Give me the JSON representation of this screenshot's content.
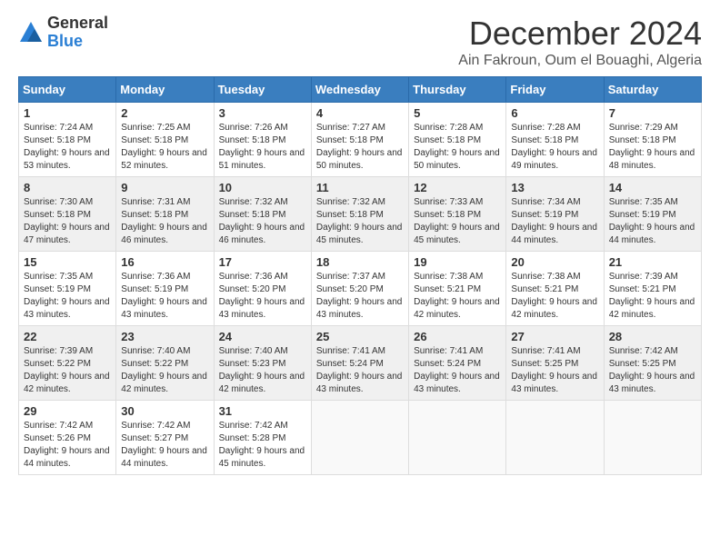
{
  "logo": {
    "general": "General",
    "blue": "Blue"
  },
  "title": "December 2024",
  "location": "Ain Fakroun, Oum el Bouaghi, Algeria",
  "headers": [
    "Sunday",
    "Monday",
    "Tuesday",
    "Wednesday",
    "Thursday",
    "Friday",
    "Saturday"
  ],
  "weeks": [
    [
      {
        "day": "1",
        "sunrise": "Sunrise: 7:24 AM",
        "sunset": "Sunset: 5:18 PM",
        "daylight": "Daylight: 9 hours and 53 minutes."
      },
      {
        "day": "2",
        "sunrise": "Sunrise: 7:25 AM",
        "sunset": "Sunset: 5:18 PM",
        "daylight": "Daylight: 9 hours and 52 minutes."
      },
      {
        "day": "3",
        "sunrise": "Sunrise: 7:26 AM",
        "sunset": "Sunset: 5:18 PM",
        "daylight": "Daylight: 9 hours and 51 minutes."
      },
      {
        "day": "4",
        "sunrise": "Sunrise: 7:27 AM",
        "sunset": "Sunset: 5:18 PM",
        "daylight": "Daylight: 9 hours and 50 minutes."
      },
      {
        "day": "5",
        "sunrise": "Sunrise: 7:28 AM",
        "sunset": "Sunset: 5:18 PM",
        "daylight": "Daylight: 9 hours and 50 minutes."
      },
      {
        "day": "6",
        "sunrise": "Sunrise: 7:28 AM",
        "sunset": "Sunset: 5:18 PM",
        "daylight": "Daylight: 9 hours and 49 minutes."
      },
      {
        "day": "7",
        "sunrise": "Sunrise: 7:29 AM",
        "sunset": "Sunset: 5:18 PM",
        "daylight": "Daylight: 9 hours and 48 minutes."
      }
    ],
    [
      {
        "day": "8",
        "sunrise": "Sunrise: 7:30 AM",
        "sunset": "Sunset: 5:18 PM",
        "daylight": "Daylight: 9 hours and 47 minutes."
      },
      {
        "day": "9",
        "sunrise": "Sunrise: 7:31 AM",
        "sunset": "Sunset: 5:18 PM",
        "daylight": "Daylight: 9 hours and 46 minutes."
      },
      {
        "day": "10",
        "sunrise": "Sunrise: 7:32 AM",
        "sunset": "Sunset: 5:18 PM",
        "daylight": "Daylight: 9 hours and 46 minutes."
      },
      {
        "day": "11",
        "sunrise": "Sunrise: 7:32 AM",
        "sunset": "Sunset: 5:18 PM",
        "daylight": "Daylight: 9 hours and 45 minutes."
      },
      {
        "day": "12",
        "sunrise": "Sunrise: 7:33 AM",
        "sunset": "Sunset: 5:18 PM",
        "daylight": "Daylight: 9 hours and 45 minutes."
      },
      {
        "day": "13",
        "sunrise": "Sunrise: 7:34 AM",
        "sunset": "Sunset: 5:19 PM",
        "daylight": "Daylight: 9 hours and 44 minutes."
      },
      {
        "day": "14",
        "sunrise": "Sunrise: 7:35 AM",
        "sunset": "Sunset: 5:19 PM",
        "daylight": "Daylight: 9 hours and 44 minutes."
      }
    ],
    [
      {
        "day": "15",
        "sunrise": "Sunrise: 7:35 AM",
        "sunset": "Sunset: 5:19 PM",
        "daylight": "Daylight: 9 hours and 43 minutes."
      },
      {
        "day": "16",
        "sunrise": "Sunrise: 7:36 AM",
        "sunset": "Sunset: 5:19 PM",
        "daylight": "Daylight: 9 hours and 43 minutes."
      },
      {
        "day": "17",
        "sunrise": "Sunrise: 7:36 AM",
        "sunset": "Sunset: 5:20 PM",
        "daylight": "Daylight: 9 hours and 43 minutes."
      },
      {
        "day": "18",
        "sunrise": "Sunrise: 7:37 AM",
        "sunset": "Sunset: 5:20 PM",
        "daylight": "Daylight: 9 hours and 43 minutes."
      },
      {
        "day": "19",
        "sunrise": "Sunrise: 7:38 AM",
        "sunset": "Sunset: 5:21 PM",
        "daylight": "Daylight: 9 hours and 42 minutes."
      },
      {
        "day": "20",
        "sunrise": "Sunrise: 7:38 AM",
        "sunset": "Sunset: 5:21 PM",
        "daylight": "Daylight: 9 hours and 42 minutes."
      },
      {
        "day": "21",
        "sunrise": "Sunrise: 7:39 AM",
        "sunset": "Sunset: 5:21 PM",
        "daylight": "Daylight: 9 hours and 42 minutes."
      }
    ],
    [
      {
        "day": "22",
        "sunrise": "Sunrise: 7:39 AM",
        "sunset": "Sunset: 5:22 PM",
        "daylight": "Daylight: 9 hours and 42 minutes."
      },
      {
        "day": "23",
        "sunrise": "Sunrise: 7:40 AM",
        "sunset": "Sunset: 5:22 PM",
        "daylight": "Daylight: 9 hours and 42 minutes."
      },
      {
        "day": "24",
        "sunrise": "Sunrise: 7:40 AM",
        "sunset": "Sunset: 5:23 PM",
        "daylight": "Daylight: 9 hours and 42 minutes."
      },
      {
        "day": "25",
        "sunrise": "Sunrise: 7:41 AM",
        "sunset": "Sunset: 5:24 PM",
        "daylight": "Daylight: 9 hours and 43 minutes."
      },
      {
        "day": "26",
        "sunrise": "Sunrise: 7:41 AM",
        "sunset": "Sunset: 5:24 PM",
        "daylight": "Daylight: 9 hours and 43 minutes."
      },
      {
        "day": "27",
        "sunrise": "Sunrise: 7:41 AM",
        "sunset": "Sunset: 5:25 PM",
        "daylight": "Daylight: 9 hours and 43 minutes."
      },
      {
        "day": "28",
        "sunrise": "Sunrise: 7:42 AM",
        "sunset": "Sunset: 5:25 PM",
        "daylight": "Daylight: 9 hours and 43 minutes."
      }
    ],
    [
      {
        "day": "29",
        "sunrise": "Sunrise: 7:42 AM",
        "sunset": "Sunset: 5:26 PM",
        "daylight": "Daylight: 9 hours and 44 minutes."
      },
      {
        "day": "30",
        "sunrise": "Sunrise: 7:42 AM",
        "sunset": "Sunset: 5:27 PM",
        "daylight": "Daylight: 9 hours and 44 minutes."
      },
      {
        "day": "31",
        "sunrise": "Sunrise: 7:42 AM",
        "sunset": "Sunset: 5:28 PM",
        "daylight": "Daylight: 9 hours and 45 minutes."
      },
      null,
      null,
      null,
      null
    ]
  ]
}
